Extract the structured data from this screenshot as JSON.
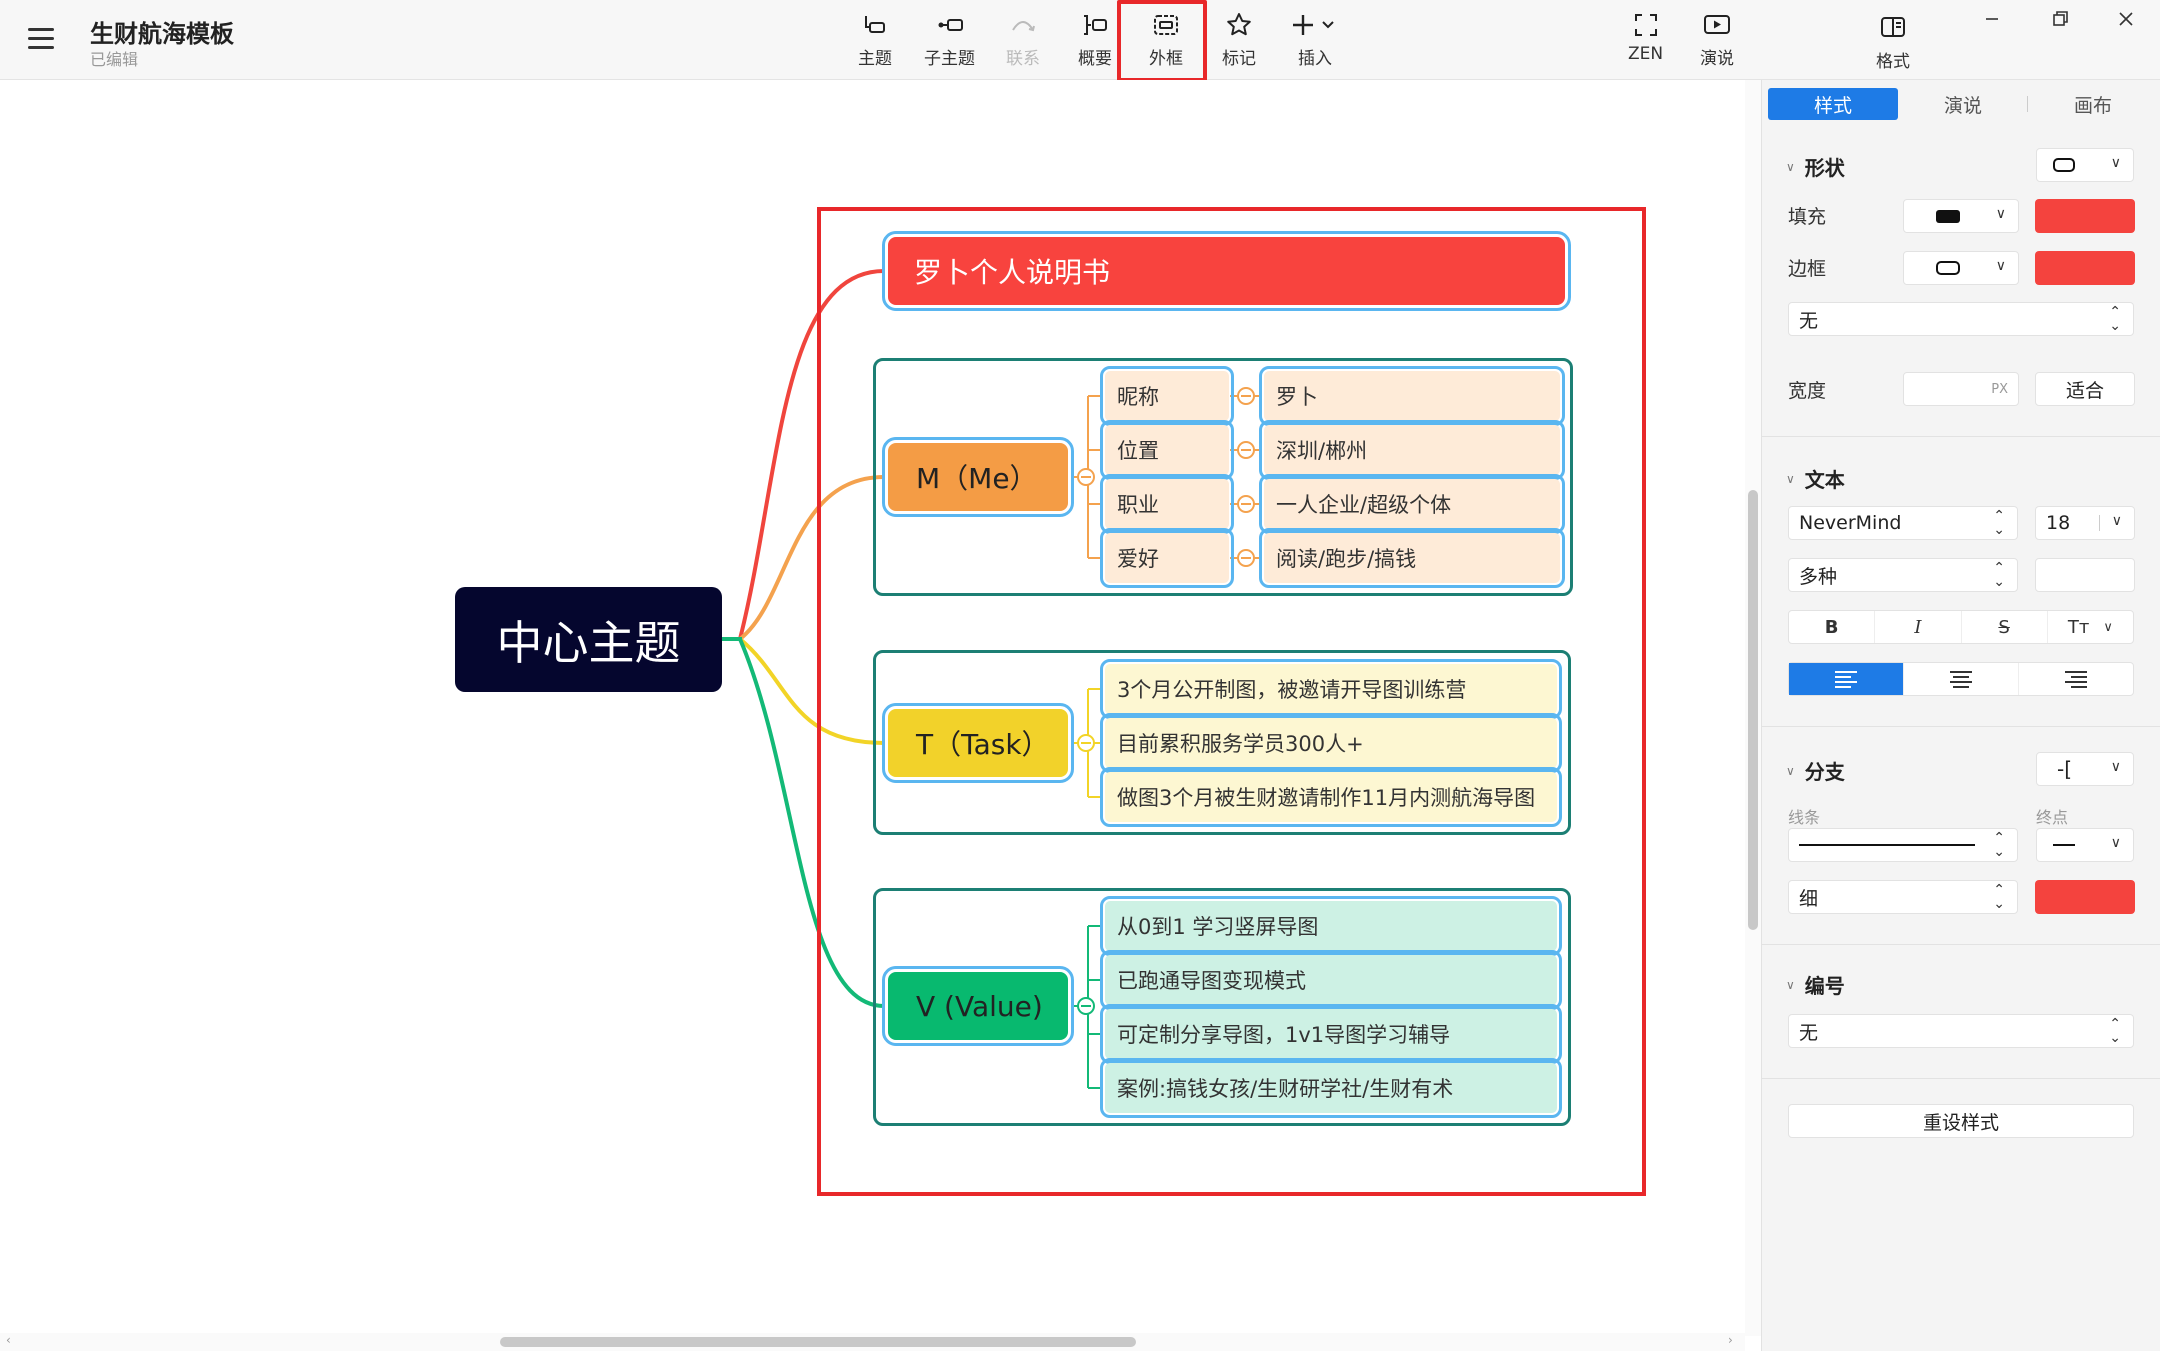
{
  "header": {
    "doc_title": "生财航海模板",
    "doc_status": "已编辑"
  },
  "toolbar": {
    "topic": "主题",
    "subtopic": "子主题",
    "relation": "联系",
    "summary": "概要",
    "boundary": "外框",
    "marker": "标记",
    "insert": "插入",
    "zen": "ZEN",
    "present": "演说",
    "format": "格式"
  },
  "mindmap": {
    "central": "中心主题",
    "title_node": "罗卜个人说明书",
    "me": {
      "label": "M（Me）",
      "rows": [
        {
          "key": "昵称",
          "value": "罗卜"
        },
        {
          "key": "位置",
          "value": "深圳/郴州"
        },
        {
          "key": "职业",
          "value": "一人企业/超级个体"
        },
        {
          "key": "爱好",
          "value": "阅读/跑步/搞钱"
        }
      ]
    },
    "task": {
      "label": "T（Task）",
      "items": [
        "3个月公开制图，被邀请开导图训练营",
        "目前累积服务学员300人+",
        "做图3个月被生财邀请制作11月内测航海导图"
      ]
    },
    "value": {
      "label": "V (Value)",
      "items": [
        "从0到1 学习竖屏导图",
        "已跑通导图变现模式",
        "可定制分享导图，1v1导图学习辅导",
        "案例:搞钱女孩/生财研学社/生财有术"
      ]
    }
  },
  "panel": {
    "tabs": [
      "样式",
      "演说",
      "画布"
    ],
    "shape": {
      "title": "形状",
      "fill_label": "填充",
      "border_label": "边框",
      "border_style": "无",
      "width_label": "宽度",
      "width_unit": "PX",
      "fit_label": "适合",
      "fill_color": "#f4433e",
      "border_color": "#f4433e"
    },
    "text": {
      "title": "文本",
      "font": "NeverMind",
      "size": "18",
      "weight": "多种",
      "bold": "B",
      "italic": "I",
      "strike": "S",
      "case": "Tт"
    },
    "branch": {
      "title": "分支",
      "line_label": "线条",
      "end_label": "终点",
      "thickness": "细",
      "color": "#f4433e"
    },
    "numbering": {
      "title": "编号",
      "value": "无"
    },
    "reset": "重设样式"
  },
  "colors": {
    "accent": "#1e7be6",
    "red": "#f8433e",
    "orange": "#f4a24e",
    "yellow": "#f2d427",
    "green": "#08b96f",
    "frame": "#1c7f74",
    "central": "#05062e"
  }
}
